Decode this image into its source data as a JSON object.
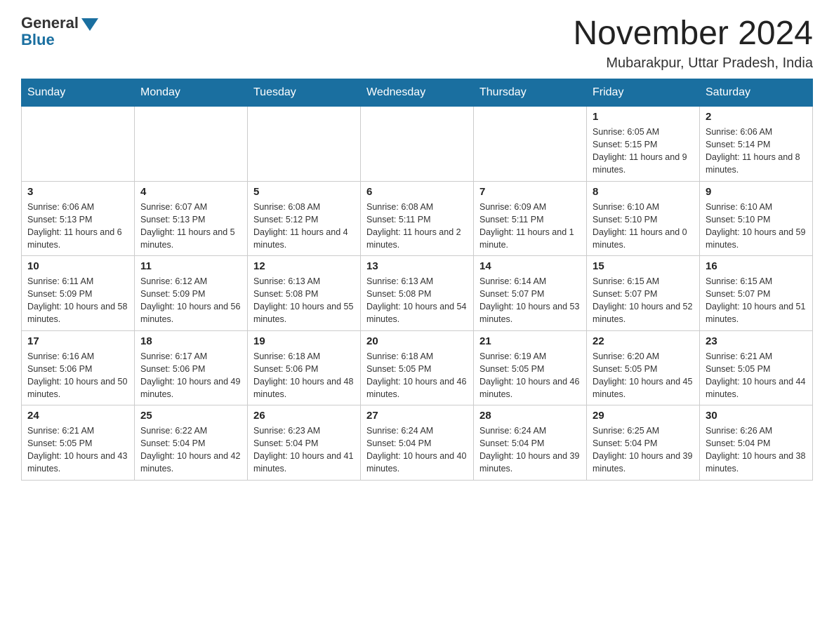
{
  "logo": {
    "general": "General",
    "blue": "Blue"
  },
  "title": "November 2024",
  "location": "Mubarakpur, Uttar Pradesh, India",
  "weekdays": [
    "Sunday",
    "Monday",
    "Tuesday",
    "Wednesday",
    "Thursday",
    "Friday",
    "Saturday"
  ],
  "weeks": [
    [
      {
        "day": "",
        "info": ""
      },
      {
        "day": "",
        "info": ""
      },
      {
        "day": "",
        "info": ""
      },
      {
        "day": "",
        "info": ""
      },
      {
        "day": "",
        "info": ""
      },
      {
        "day": "1",
        "info": "Sunrise: 6:05 AM\nSunset: 5:15 PM\nDaylight: 11 hours and 9 minutes."
      },
      {
        "day": "2",
        "info": "Sunrise: 6:06 AM\nSunset: 5:14 PM\nDaylight: 11 hours and 8 minutes."
      }
    ],
    [
      {
        "day": "3",
        "info": "Sunrise: 6:06 AM\nSunset: 5:13 PM\nDaylight: 11 hours and 6 minutes."
      },
      {
        "day": "4",
        "info": "Sunrise: 6:07 AM\nSunset: 5:13 PM\nDaylight: 11 hours and 5 minutes."
      },
      {
        "day": "5",
        "info": "Sunrise: 6:08 AM\nSunset: 5:12 PM\nDaylight: 11 hours and 4 minutes."
      },
      {
        "day": "6",
        "info": "Sunrise: 6:08 AM\nSunset: 5:11 PM\nDaylight: 11 hours and 2 minutes."
      },
      {
        "day": "7",
        "info": "Sunrise: 6:09 AM\nSunset: 5:11 PM\nDaylight: 11 hours and 1 minute."
      },
      {
        "day": "8",
        "info": "Sunrise: 6:10 AM\nSunset: 5:10 PM\nDaylight: 11 hours and 0 minutes."
      },
      {
        "day": "9",
        "info": "Sunrise: 6:10 AM\nSunset: 5:10 PM\nDaylight: 10 hours and 59 minutes."
      }
    ],
    [
      {
        "day": "10",
        "info": "Sunrise: 6:11 AM\nSunset: 5:09 PM\nDaylight: 10 hours and 58 minutes."
      },
      {
        "day": "11",
        "info": "Sunrise: 6:12 AM\nSunset: 5:09 PM\nDaylight: 10 hours and 56 minutes."
      },
      {
        "day": "12",
        "info": "Sunrise: 6:13 AM\nSunset: 5:08 PM\nDaylight: 10 hours and 55 minutes."
      },
      {
        "day": "13",
        "info": "Sunrise: 6:13 AM\nSunset: 5:08 PM\nDaylight: 10 hours and 54 minutes."
      },
      {
        "day": "14",
        "info": "Sunrise: 6:14 AM\nSunset: 5:07 PM\nDaylight: 10 hours and 53 minutes."
      },
      {
        "day": "15",
        "info": "Sunrise: 6:15 AM\nSunset: 5:07 PM\nDaylight: 10 hours and 52 minutes."
      },
      {
        "day": "16",
        "info": "Sunrise: 6:15 AM\nSunset: 5:07 PM\nDaylight: 10 hours and 51 minutes."
      }
    ],
    [
      {
        "day": "17",
        "info": "Sunrise: 6:16 AM\nSunset: 5:06 PM\nDaylight: 10 hours and 50 minutes."
      },
      {
        "day": "18",
        "info": "Sunrise: 6:17 AM\nSunset: 5:06 PM\nDaylight: 10 hours and 49 minutes."
      },
      {
        "day": "19",
        "info": "Sunrise: 6:18 AM\nSunset: 5:06 PM\nDaylight: 10 hours and 48 minutes."
      },
      {
        "day": "20",
        "info": "Sunrise: 6:18 AM\nSunset: 5:05 PM\nDaylight: 10 hours and 46 minutes."
      },
      {
        "day": "21",
        "info": "Sunrise: 6:19 AM\nSunset: 5:05 PM\nDaylight: 10 hours and 46 minutes."
      },
      {
        "day": "22",
        "info": "Sunrise: 6:20 AM\nSunset: 5:05 PM\nDaylight: 10 hours and 45 minutes."
      },
      {
        "day": "23",
        "info": "Sunrise: 6:21 AM\nSunset: 5:05 PM\nDaylight: 10 hours and 44 minutes."
      }
    ],
    [
      {
        "day": "24",
        "info": "Sunrise: 6:21 AM\nSunset: 5:05 PM\nDaylight: 10 hours and 43 minutes."
      },
      {
        "day": "25",
        "info": "Sunrise: 6:22 AM\nSunset: 5:04 PM\nDaylight: 10 hours and 42 minutes."
      },
      {
        "day": "26",
        "info": "Sunrise: 6:23 AM\nSunset: 5:04 PM\nDaylight: 10 hours and 41 minutes."
      },
      {
        "day": "27",
        "info": "Sunrise: 6:24 AM\nSunset: 5:04 PM\nDaylight: 10 hours and 40 minutes."
      },
      {
        "day": "28",
        "info": "Sunrise: 6:24 AM\nSunset: 5:04 PM\nDaylight: 10 hours and 39 minutes."
      },
      {
        "day": "29",
        "info": "Sunrise: 6:25 AM\nSunset: 5:04 PM\nDaylight: 10 hours and 39 minutes."
      },
      {
        "day": "30",
        "info": "Sunrise: 6:26 AM\nSunset: 5:04 PM\nDaylight: 10 hours and 38 minutes."
      }
    ]
  ]
}
